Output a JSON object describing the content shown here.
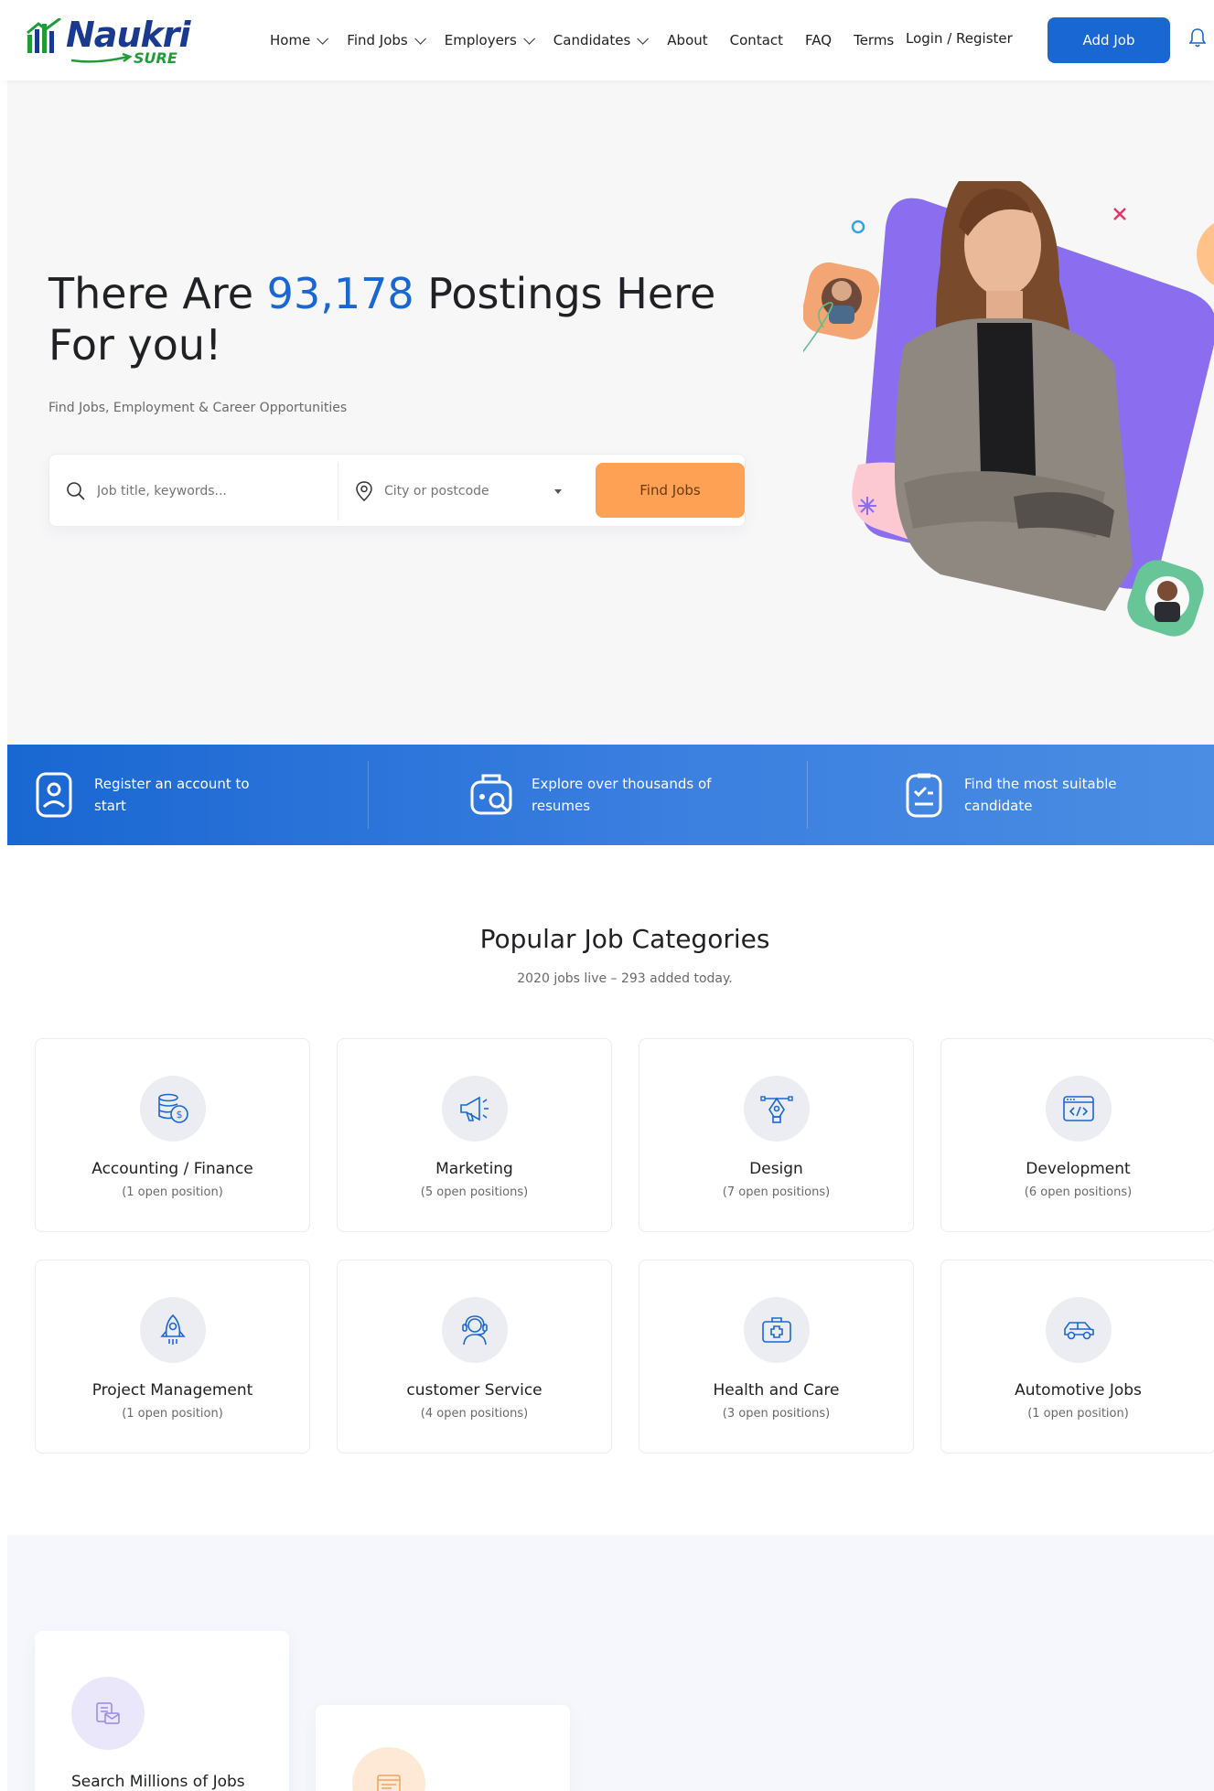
{
  "header": {
    "logo_text": "Naukri",
    "logo_sub": "SURE",
    "nav": [
      {
        "label": "Home",
        "dropdown": true
      },
      {
        "label": "Find Jobs",
        "dropdown": true
      },
      {
        "label": "Employers",
        "dropdown": true
      },
      {
        "label": "Candidates",
        "dropdown": true
      },
      {
        "label": "About",
        "dropdown": false
      },
      {
        "label": "Contact",
        "dropdown": false
      },
      {
        "label": "FAQ",
        "dropdown": false
      },
      {
        "label": "Terms",
        "dropdown": false
      }
    ],
    "login_label": "Login / Register",
    "add_job_label": "Add Job",
    "icons": {
      "bell": "bell-icon"
    }
  },
  "hero": {
    "title_pre": "There Are ",
    "title_count": "93,178",
    "title_post": " Postings Here For you!",
    "subtitle": "Find Jobs, Employment & Career Opportunities",
    "search": {
      "keyword_placeholder": "Job title, keywords...",
      "location_placeholder": "City or postcode",
      "button_label": "Find Jobs"
    }
  },
  "strip": {
    "items": [
      {
        "icon": "user-badge-icon",
        "text": "Register an account to start"
      },
      {
        "icon": "resume-search-icon",
        "text": "Explore over thousands of resumes"
      },
      {
        "icon": "checklist-icon",
        "text": "Find the most suitable candidate"
      }
    ]
  },
  "categories": {
    "title": "Popular Job Categories",
    "subtitle": "2020 jobs live – 293 added today.",
    "items": [
      {
        "name": "Accounting / Finance",
        "count": "(1 open position)",
        "icon": "money-coins-icon"
      },
      {
        "name": "Marketing",
        "count": "(5 open positions)",
        "icon": "megaphone-icon"
      },
      {
        "name": "Design",
        "count": "(7 open positions)",
        "icon": "pen-tool-icon"
      },
      {
        "name": "Development",
        "count": "(6 open positions)",
        "icon": "code-window-icon"
      },
      {
        "name": "Project Management",
        "count": "(1 open position)",
        "icon": "rocket-icon"
      },
      {
        "name": "customer Service",
        "count": "(4 open positions)",
        "icon": "headset-agent-icon"
      },
      {
        "name": "Health and Care",
        "count": "(3 open positions)",
        "icon": "first-aid-kit-icon"
      },
      {
        "name": "Automotive Jobs",
        "count": "(1 open position)",
        "icon": "car-icon"
      }
    ]
  },
  "bottom": {
    "card1_label": "Search Millions of Jobs",
    "card1_icon": "job-search-icon",
    "card2_icon": "job-listing-icon"
  },
  "colors": {
    "primary": "#1967d2",
    "orange": "#ffa154",
    "purple": "#8b6ef0",
    "pink": "#fcc9d3",
    "text": "#202124",
    "muted": "#696969"
  }
}
